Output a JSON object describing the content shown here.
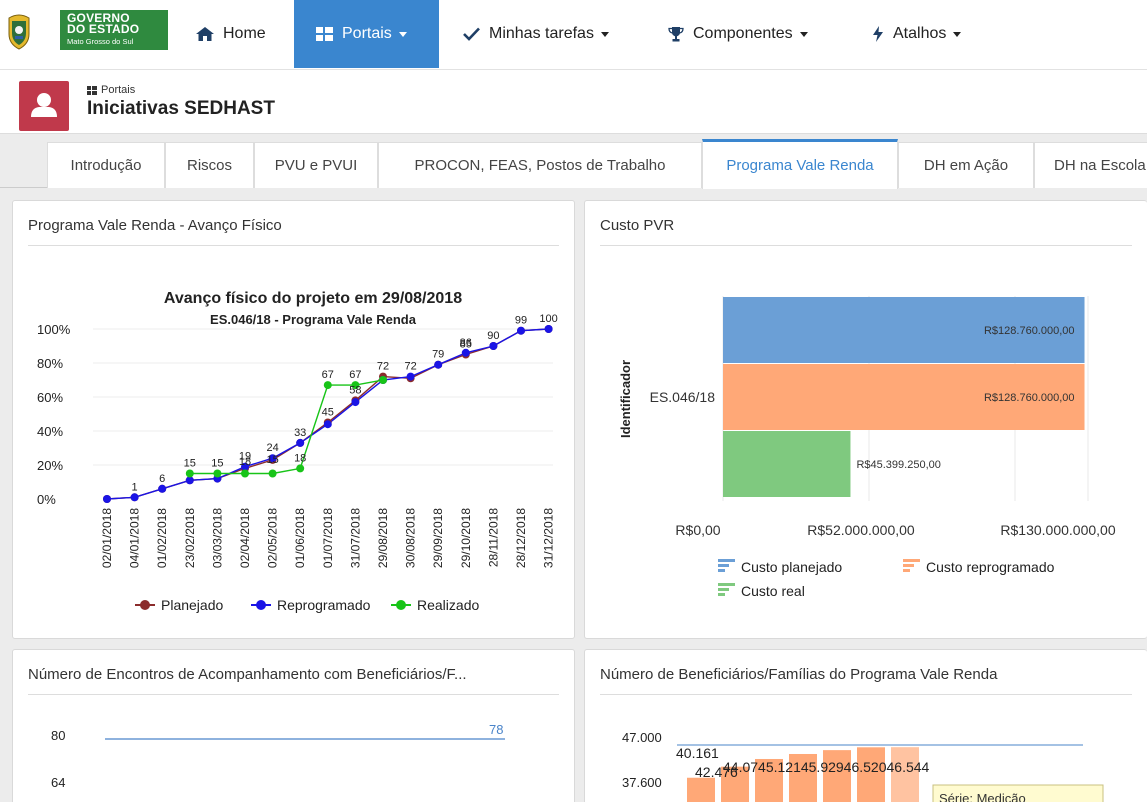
{
  "brand": {
    "line1": "GOVERNO",
    "line2": "DO ESTADO",
    "line3": "Mato Grosso do Sul",
    "colors": {
      "green": "#2f8a3f",
      "accent": "#3a86cf"
    }
  },
  "nav": [
    {
      "label": "Home",
      "icon": "home-icon",
      "active": false,
      "dropdown": false
    },
    {
      "label": "Portais",
      "icon": "portals-grid-icon",
      "active": true,
      "dropdown": true
    },
    {
      "label": "Minhas tarefas",
      "icon": "checkmark-icon",
      "active": false,
      "dropdown": true
    },
    {
      "label": "Componentes",
      "icon": "trophy-icon",
      "active": false,
      "dropdown": true
    },
    {
      "label": "Atalhos",
      "icon": "bolt-icon",
      "active": false,
      "dropdown": true
    }
  ],
  "header": {
    "breadcrumb": "Portais",
    "title": "Iniciativas SEDHAST",
    "avatar_icon": "user-icon"
  },
  "tabs": [
    {
      "label": "Introdução",
      "active": false
    },
    {
      "label": "Riscos",
      "active": false
    },
    {
      "label": "PVU e PVUI",
      "active": false
    },
    {
      "label": "PROCON, FEAS, Postos de Trabalho",
      "active": false
    },
    {
      "label": "Programa Vale Renda",
      "active": true
    },
    {
      "label": "DH em Ação",
      "active": false
    },
    {
      "label": "DH na Escola",
      "active": false
    }
  ],
  "panels": {
    "avanco": {
      "title": "Programa Vale Renda - Avanço Físico"
    },
    "custo": {
      "title": "Custo PVR"
    },
    "encontros": {
      "title": "Número de Encontros de Acompanhamento com Beneficiários/F..."
    },
    "beneficiarios": {
      "title": "Número de Beneficiários/Famílias do Programa Vale Renda"
    }
  },
  "chart_data": [
    {
      "type": "line",
      "title": "Avanço físico do projeto em 29/08/2018",
      "subtitle": "ES.046/18 - Programa Vale Renda",
      "y_unit": "%",
      "ylim": [
        0,
        100
      ],
      "y_ticks": [
        "0%",
        "20%",
        "40%",
        "60%",
        "80%",
        "100%"
      ],
      "x": [
        "02/01/2018",
        "04/01/2018",
        "01/02/2018",
        "23/02/2018",
        "03/03/2018",
        "02/04/2018",
        "02/05/2018",
        "01/06/2018",
        "01/07/2018",
        "31/07/2018",
        "29/08/2018",
        "30/08/2018",
        "29/09/2018",
        "29/10/2018",
        "28/11/2018",
        "28/12/2018",
        "31/12/2018"
      ],
      "series": [
        {
          "name": "Planejado",
          "color": "#8b2c2c",
          "values": [
            0,
            1,
            6,
            11,
            12,
            18,
            23,
            33,
            45,
            58,
            72,
            71,
            79,
            85,
            90,
            99,
            100
          ]
        },
        {
          "name": "Reprogramado",
          "color": "#1a14e6",
          "values": [
            0,
            1,
            6,
            11,
            12,
            19,
            24,
            33,
            44,
            57,
            70,
            72,
            79,
            86,
            90,
            99,
            100
          ]
        },
        {
          "name": "Realizado",
          "color": "#18c418",
          "values": [
            null,
            null,
            null,
            15,
            15,
            15,
            15,
            18,
            67,
            67,
            70,
            null,
            null,
            null,
            null,
            null,
            null
          ]
        }
      ],
      "point_labels": [
        {
          "text": "1",
          "xi": 1,
          "v": 1
        },
        {
          "text": "6",
          "xi": 2,
          "v": 6
        },
        {
          "text": "15",
          "xi": 3,
          "v": 15
        },
        {
          "text": "15",
          "xi": 4,
          "v": 15
        },
        {
          "text": "19",
          "xi": 5,
          "v": 19
        },
        {
          "text": "18",
          "xi": 5,
          "v": 16
        },
        {
          "text": "24",
          "xi": 6,
          "v": 24
        },
        {
          "text": "15",
          "xi": 6,
          "v": 17
        },
        {
          "text": "33",
          "xi": 7,
          "v": 33
        },
        {
          "text": "18",
          "xi": 7,
          "v": 18
        },
        {
          "text": "45",
          "xi": 8,
          "v": 45
        },
        {
          "text": "67",
          "xi": 8,
          "v": 67
        },
        {
          "text": "67",
          "xi": 9,
          "v": 67
        },
        {
          "text": "58",
          "xi": 9,
          "v": 58
        },
        {
          "text": "72",
          "xi": 10,
          "v": 72
        },
        {
          "text": "72",
          "xi": 11,
          "v": 72
        },
        {
          "text": "79",
          "xi": 12,
          "v": 79
        },
        {
          "text": "85",
          "xi": 13,
          "v": 85
        },
        {
          "text": "86",
          "xi": 13,
          "v": 86
        },
        {
          "text": "90",
          "xi": 14,
          "v": 90
        },
        {
          "text": "99",
          "xi": 15,
          "v": 99
        },
        {
          "text": "100",
          "xi": 16,
          "v": 100
        }
      ],
      "legend": "bottom"
    },
    {
      "type": "bar",
      "orientation": "horizontal",
      "ylabel": "Identificador",
      "categories": [
        "ES.046/18"
      ],
      "series": [
        {
          "name": "Custo planejado",
          "color": "#6b9fd6",
          "values": [
            128760000
          ],
          "label": "R$128.760.000,00"
        },
        {
          "name": "Custo reprogramado",
          "color": "#ffa877",
          "values": [
            128760000
          ],
          "label": "R$128.760.000,00"
        },
        {
          "name": "Custo real",
          "color": "#7fc97f",
          "values": [
            45399250
          ],
          "label": "R$45.399.250,00"
        }
      ],
      "xlim": [
        0,
        130000000
      ],
      "x_ticks": [
        "R$0,00",
        "R$52.000.000,00",
        "R$130.000.000,00"
      ],
      "legend": "bottom"
    },
    {
      "type": "line",
      "y_ticks": [
        "80",
        "64"
      ],
      "series": [
        {
          "values": [
            78
          ],
          "labels": [
            "78"
          ]
        }
      ]
    },
    {
      "type": "bar",
      "y_ticks": [
        "47.000",
        "37.600"
      ],
      "values": [
        40161,
        42476,
        44079,
        45121,
        45929,
        46520,
        46544
      ],
      "labels": [
        "40.161",
        "42.476",
        "44.079",
        "45.121",
        "45.929",
        "46.520",
        "46.544"
      ],
      "overlapped_label_text": "44.0745.12145.92946.52046.544",
      "tooltip": "Série: Medição"
    }
  ]
}
